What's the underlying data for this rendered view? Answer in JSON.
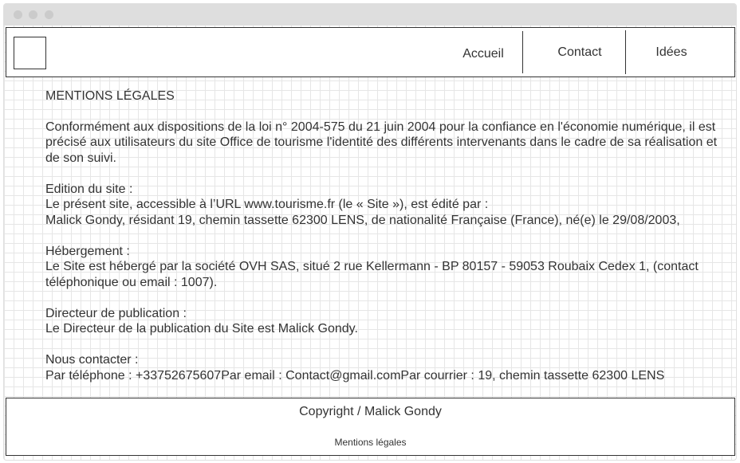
{
  "header": {
    "nav": {
      "accueil": "Accueil",
      "contact": "Contact",
      "idees": "Idées"
    }
  },
  "main": {
    "title": "MENTIONS LÉGALES",
    "intro": "Conformément aux dispositions de la loi n° 2004-575 du 21 juin 2004 pour la confiance en l'économie numérique, il est précisé aux utilisateurs du site Office de tourisme l'identité des différents intervenants dans le cadre de sa réalisation et de son suivi.",
    "edition": {
      "heading": "Edition du site :",
      "line1": "Le présent site, accessible à l’URL www.tourisme.fr (le « Site »), est édité par :",
      "line2": "Malick Gondy, résidant 19, chemin tassette 62300 LENS, de nationalité Française (France), né(e) le 29/08/2003,"
    },
    "hebergement": {
      "heading": "Hébergement :",
      "text": "Le Site est hébergé par la société OVH SAS, situé 2 rue Kellermann - BP 80157 - 59053 Roubaix Cedex 1, (contact téléphonique ou email : 1007)."
    },
    "directeur": {
      "heading": "Directeur de publication :",
      "text": "Le Directeur de la publication du Site est Malick Gondy."
    },
    "contact": {
      "heading": "Nous contacter :",
      "text": "Par téléphone : +33752675607Par email : Contact@gmail.comPar courrier : 19, chemin tassette 62300 LENS"
    }
  },
  "footer": {
    "copyright": "Copyright / Malick Gondy",
    "legal_link": "Mentions légales"
  }
}
